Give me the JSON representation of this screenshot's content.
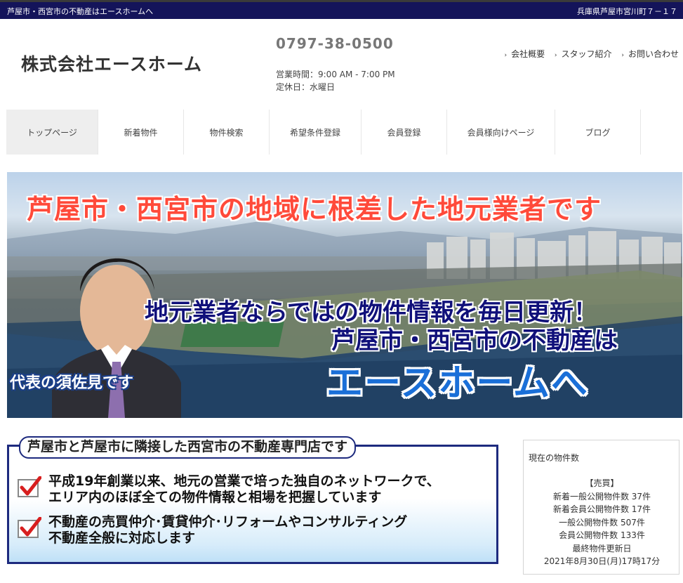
{
  "topbar": {
    "left_text": "芦屋市・西宮市の不動産はエースホームへ",
    "right_text": "兵庫県芦屋市宮川町７－１７"
  },
  "header": {
    "company": "株式会社エースホーム",
    "phone": "0797-38-0500",
    "hours": "営業時間：9:00 AM - 7:00 PM",
    "closed": "定休日：水曜日",
    "links": [
      "会社概要",
      "スタッフ紹介",
      "お問い合わせ"
    ]
  },
  "nav": {
    "items": [
      "トップページ",
      "新着物件",
      "物件検索",
      "希望条件登録",
      "会員登録",
      "会員様向けページ",
      "ブログ"
    ]
  },
  "hero": {
    "headline": "芦屋市・西宮市の地域に根差した地元業者です",
    "sub1": "地元業者ならではの物件情報を毎日更新！",
    "sub2": "芦屋市・西宮市の不動産は",
    "brand": "エースホームへ",
    "caption": "代表の須佐見です"
  },
  "info": {
    "tag": "芦屋市と芦屋市に隣接した西宮市の不動産専門店です",
    "point1_line1": "平成19年創業以来、地元の営業で培った独自のネットワークで、",
    "point1_line2": "エリア内のほぼ全ての物件情報と相場を把握しています",
    "point2_line1": "不動産の売買仲介･賃貸仲介･リフォームやコンサルティング",
    "point2_line2": "不動産全般に対応します"
  },
  "count": {
    "title": "現在の物件数",
    "section": "【売買】",
    "row1": "新着一般公開物件数 37件",
    "row2": "新着会員公開物件数 17件",
    "row3": "一般公開物件数 507件",
    "row4": "会員公開物件数 133件",
    "row5": "最終物件更新日",
    "row6": "2021年8月30日(月)17時17分"
  },
  "colors": {
    "topbar": "#14145a",
    "headline": "#ff4a3a",
    "brand": "#1a6fd8",
    "check": "#d81e1e"
  }
}
